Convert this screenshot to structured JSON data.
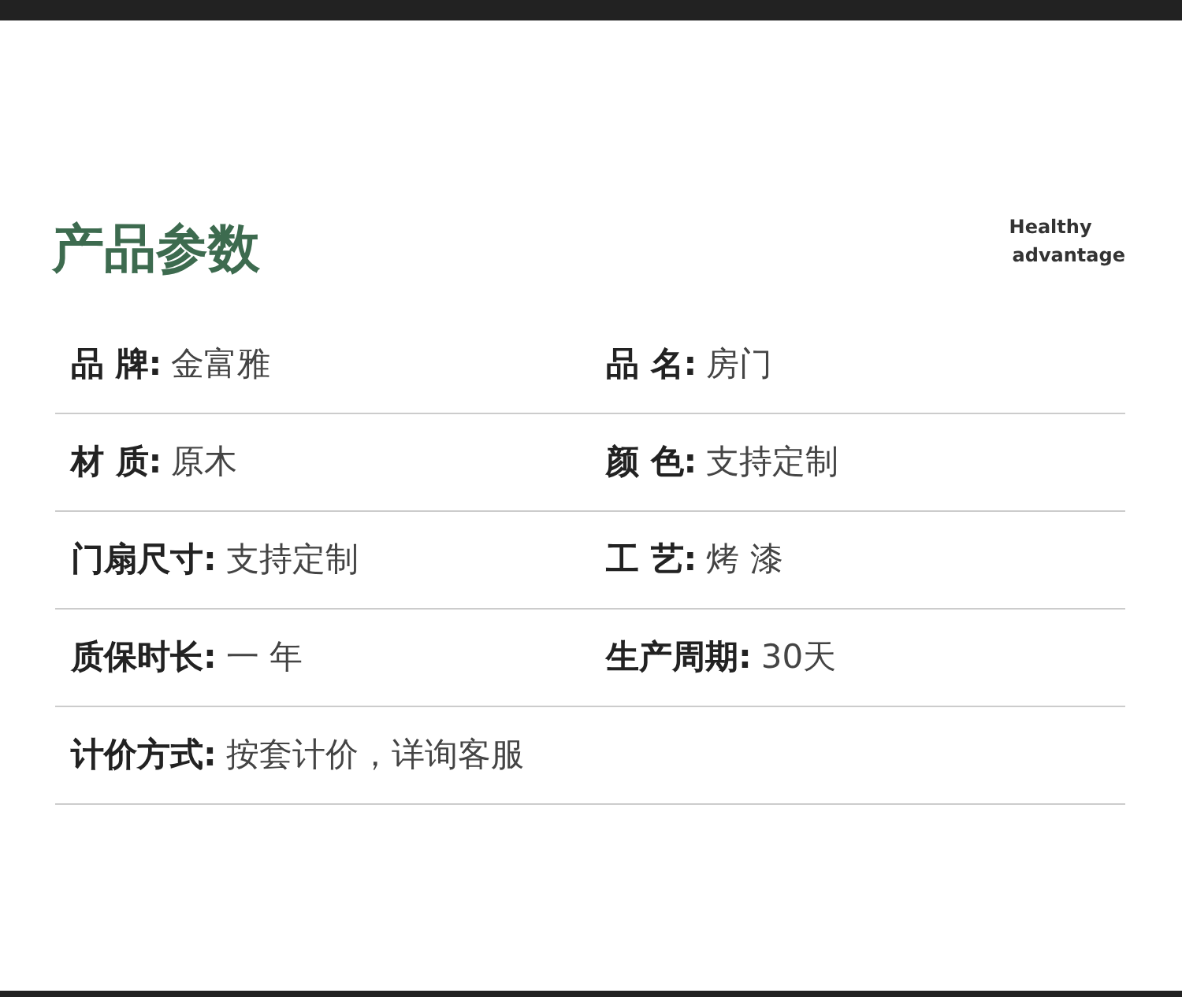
{
  "title": "产品参数",
  "tagline": [
    "Healthy",
    "advantage"
  ],
  "rows": [
    [
      {
        "label": "品 牌:",
        "value": "金富雅"
      },
      {
        "label": "品 名:",
        "value": "房门"
      }
    ],
    [
      {
        "label": "材 质:",
        "value": "原木"
      },
      {
        "label": "颜 色:",
        "value": "支持定制"
      }
    ],
    [
      {
        "label": "门扇尺寸:",
        "value": "支持定制"
      },
      {
        "label": "工 艺:",
        "value": "烤 漆"
      }
    ],
    [
      {
        "label": "质保时长:",
        "value": "一 年"
      },
      {
        "label": "生产周期:",
        "value": "30天"
      }
    ],
    [
      {
        "label": "计价方式:",
        "value": "按套计价，详询客服"
      }
    ]
  ]
}
